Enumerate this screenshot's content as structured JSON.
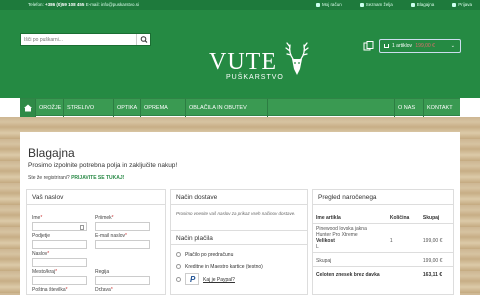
{
  "topbar": {
    "phone_prefix": "Telefon: ",
    "phone": "+386 (0)59 108 455",
    "email_prefix": " E-mail: ",
    "email": "info@puskarstvo.si",
    "links": [
      "Moj račun",
      "Seznam želja",
      "Blagajna",
      "Prijava"
    ]
  },
  "search": {
    "placeholder": "Išči po puškarni..."
  },
  "logo": {
    "wordmark": "VUTE",
    "tagline": "PUŠKARSTVO"
  },
  "cart": {
    "label": "1 artiklov",
    "price": "199,00 €"
  },
  "nav": {
    "items": [
      "OROŽJE",
      "STRELIVO",
      "OPTIKA",
      "OPREMA",
      "OBLAČILA IN OBUTEV",
      "O NAS",
      "KONTAKT"
    ]
  },
  "page": {
    "title": "Blagajna",
    "subtitle": "Prosimo izpolnite potrebna polja in zaključite nakup!",
    "login_q": "Ste že registrirani?",
    "login_link": "PRIJAVITE SE TUKAJ!"
  },
  "address": {
    "heading": "Vaš naslov",
    "fields": {
      "ime": "Ime",
      "priimek": "Priimek",
      "podjetje": "Podjetje",
      "email": "E-mail naslov",
      "naslov": "Naslov",
      "mesto": "Mesto/kraj",
      "regija": "Regija",
      "posta": "Poštna številka",
      "drzava": "Država"
    },
    "req": "*"
  },
  "shipping": {
    "heading": "Način dostave",
    "note": "Prosimo vnesite vaš naslov za prikaz vseh načinov dostave.",
    "payment_heading": "Način plačila",
    "payment_options": [
      "Plačilo po predračunu",
      "Kreditne in Maestro kartice (testno)",
      "Kaj je Paypal?"
    ]
  },
  "order": {
    "heading": "Pregled naročenega",
    "cols": [
      "Ime artikla",
      "Količina",
      "Skupaj"
    ],
    "item_lines": [
      "Pinewood lovska jakna",
      "Hunter Pro Xtreme"
    ],
    "size_label": "Velikost",
    "size_value": "L",
    "qty": "1",
    "item_total": "199,00 €",
    "subtotal_label": "Skupaj",
    "subtotal": "199,00 €",
    "net_label": "Celoten znesek brez davka",
    "net": "163,11 €"
  },
  "colors": {
    "brand_green": "#258a43",
    "nav_green": "#3a9a52",
    "link_green": "#2a8a47"
  }
}
